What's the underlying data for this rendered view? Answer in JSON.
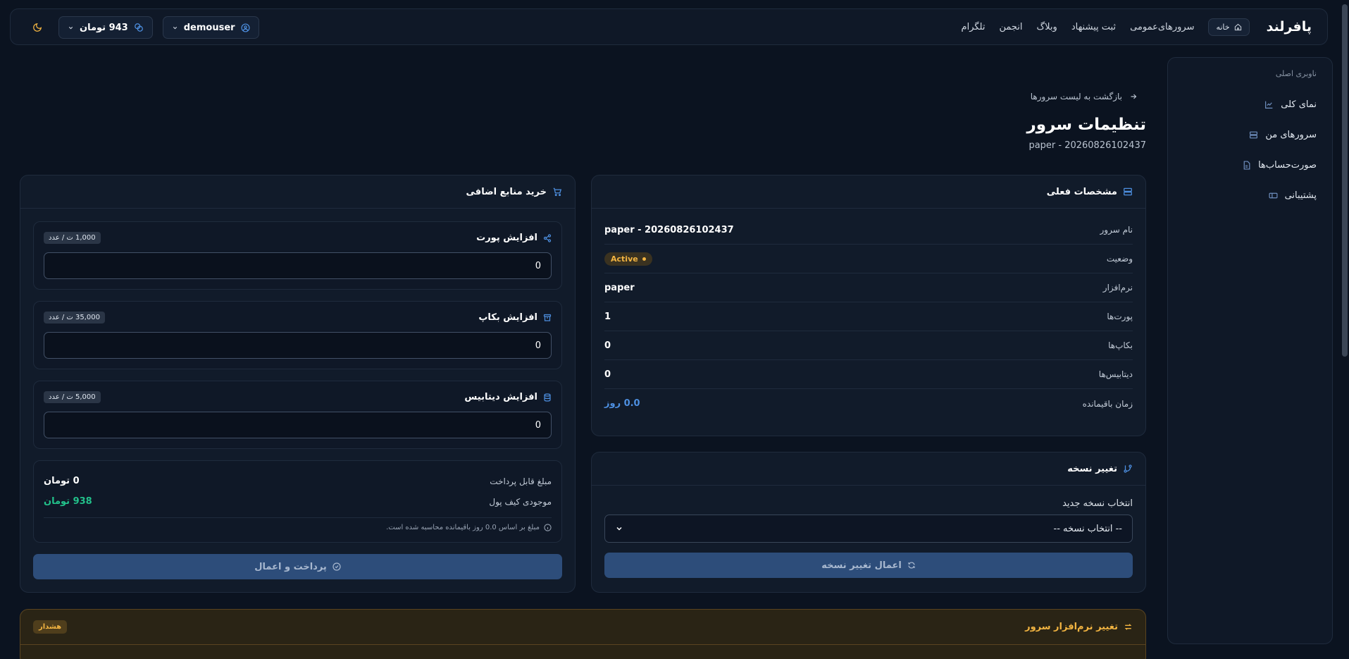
{
  "topbar": {
    "brand": "پافرلند",
    "home_label": "خانه",
    "nav": [
      "سرورهای‌عمومی",
      "ثبت پیشنهاد",
      "وبلاگ",
      "انجمن",
      "تلگرام"
    ],
    "balance": "943 تومان",
    "username": "demouser"
  },
  "sidebar": {
    "heading": "ناوبری اصلی",
    "items": [
      "نمای کلی",
      "سرورهای من",
      "صورت‌حساب‌ها",
      "پشتیبانی"
    ]
  },
  "header": {
    "back": "بازگشت به لیست سرورها",
    "title": "تنظیمات سرور",
    "subtitle": "paper - 20260826102437"
  },
  "specs": {
    "title": "مشخصات فعلی",
    "rows": [
      {
        "label": "نام سرور",
        "value": "paper - 20260826102437"
      },
      {
        "label": "وضعیت",
        "value": "Active"
      },
      {
        "label": "نرم‌افزار",
        "value": "paper"
      },
      {
        "label": "پورت‌ها",
        "value": "1"
      },
      {
        "label": "بکاپ‌ها",
        "value": "0"
      },
      {
        "label": "دیتابیس‌ها",
        "value": "0"
      },
      {
        "label": "زمان باقیمانده",
        "value": "0.0 روز"
      }
    ]
  },
  "version": {
    "title": "تغییر نسخه",
    "field_label": "انتخاب نسخه جدید",
    "select_value": "-- انتخاب نسخه --",
    "apply": "اعمال تغییر نسخه"
  },
  "buy": {
    "title": "خرید منابع اضافی",
    "items": [
      {
        "name": "افزایش پورت",
        "price": "1,000 ت / عدد",
        "value": "0"
      },
      {
        "name": "افزایش بکاپ",
        "price": "35,000 ت / عدد",
        "value": "0"
      },
      {
        "name": "افزایش دیتابیس",
        "price": "5,000 ت / عدد",
        "value": "0"
      }
    ],
    "payable_label": "مبلغ قابل پرداخت",
    "payable_value": "0 تومان",
    "wallet_label": "موجودی کیف پول",
    "wallet_value": "938 تومان",
    "note": "مبلغ بر اساس 0.0 روز باقیمانده محاسبه شده است.",
    "pay": "پرداخت و اعمال"
  },
  "warning": {
    "title": "تغییر نرم‌افزار سرور",
    "badge": "هشدار"
  },
  "colors": {
    "accent": "#4d8fe0",
    "warning": "#f2b441",
    "success": "#22c08a"
  }
}
